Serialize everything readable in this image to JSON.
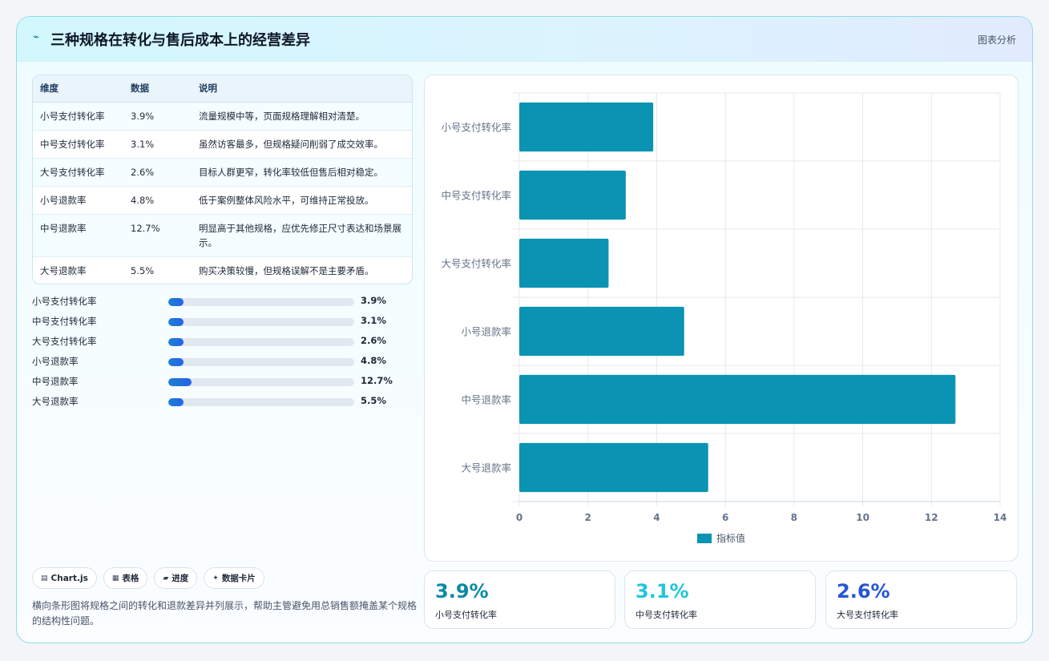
{
  "header": {
    "icon": "pulse-icon",
    "title": "三种规格在转化与售后成本上的经营差异",
    "tag": "图表分析"
  },
  "table": {
    "columns": [
      "维度",
      "数据",
      "说明"
    ],
    "rows": [
      {
        "dim": "小号支付转化率",
        "value": "3.9%",
        "note": "流量规模中等，页面规格理解相对清楚。"
      },
      {
        "dim": "中号支付转化率",
        "value": "3.1%",
        "note": "虽然访客最多，但规格疑问削弱了成交效率。"
      },
      {
        "dim": "大号支付转化率",
        "value": "2.6%",
        "note": "目标人群更窄，转化率较低但售后相对稳定。"
      },
      {
        "dim": "小号退款率",
        "value": "4.8%",
        "note": "低于案例整体风险水平，可维持正常投放。"
      },
      {
        "dim": "中号退款率",
        "value": "12.7%",
        "note": "明显高于其他规格，应优先修正尺寸表达和场景展示。"
      },
      {
        "dim": "大号退款率",
        "value": "5.5%",
        "note": "购买决策较慢，但规格误解不是主要矛盾。"
      }
    ]
  },
  "progress": [
    {
      "label": "小号支付转化率",
      "value": 3.9,
      "display": "3.9%"
    },
    {
      "label": "中号支付转化率",
      "value": 3.1,
      "display": "3.1%"
    },
    {
      "label": "大号支付转化率",
      "value": 2.6,
      "display": "2.6%"
    },
    {
      "label": "小号退款率",
      "value": 4.8,
      "display": "4.8%"
    },
    {
      "label": "中号退款率",
      "value": 12.7,
      "display": "12.7%"
    },
    {
      "label": "大号退款率",
      "value": 5.5,
      "display": "5.5%"
    }
  ],
  "chips": [
    {
      "icon": "chart-icon",
      "glyph": "▤",
      "label": "Chart.js"
    },
    {
      "icon": "table-icon",
      "glyph": "▦",
      "label": "表格"
    },
    {
      "icon": "progress-icon",
      "glyph": "▰",
      "label": "进度"
    },
    {
      "icon": "sparkle-icon",
      "glyph": "✦",
      "label": "数据卡片"
    }
  ],
  "description": "横向条形图将规格之间的转化和退款差异并列展示，帮助主管避免用总销售额掩盖某个规格的结构性问题。",
  "chart_data": {
    "type": "bar",
    "orientation": "horizontal",
    "categories": [
      "小号支付转化率",
      "中号支付转化率",
      "大号支付转化率",
      "小号退款率",
      "中号退款率",
      "大号退款率"
    ],
    "series": [
      {
        "name": "指标值",
        "values": [
          3.9,
          3.1,
          2.6,
          4.8,
          12.7,
          5.5
        ],
        "color": "#0a93b3"
      }
    ],
    "xlim": [
      0,
      14
    ],
    "xticks": [
      0,
      2,
      4,
      6,
      8,
      10,
      12,
      14
    ],
    "grid": true,
    "legend": "bottom"
  },
  "stats": [
    {
      "value": "3.9%",
      "label": "小号支付转化率",
      "color": "#0a8aa6"
    },
    {
      "value": "3.1%",
      "label": "中号支付转化率",
      "color": "#22c5dd"
    },
    {
      "value": "2.6%",
      "label": "大号支付转化率",
      "color": "#2457d6"
    }
  ]
}
